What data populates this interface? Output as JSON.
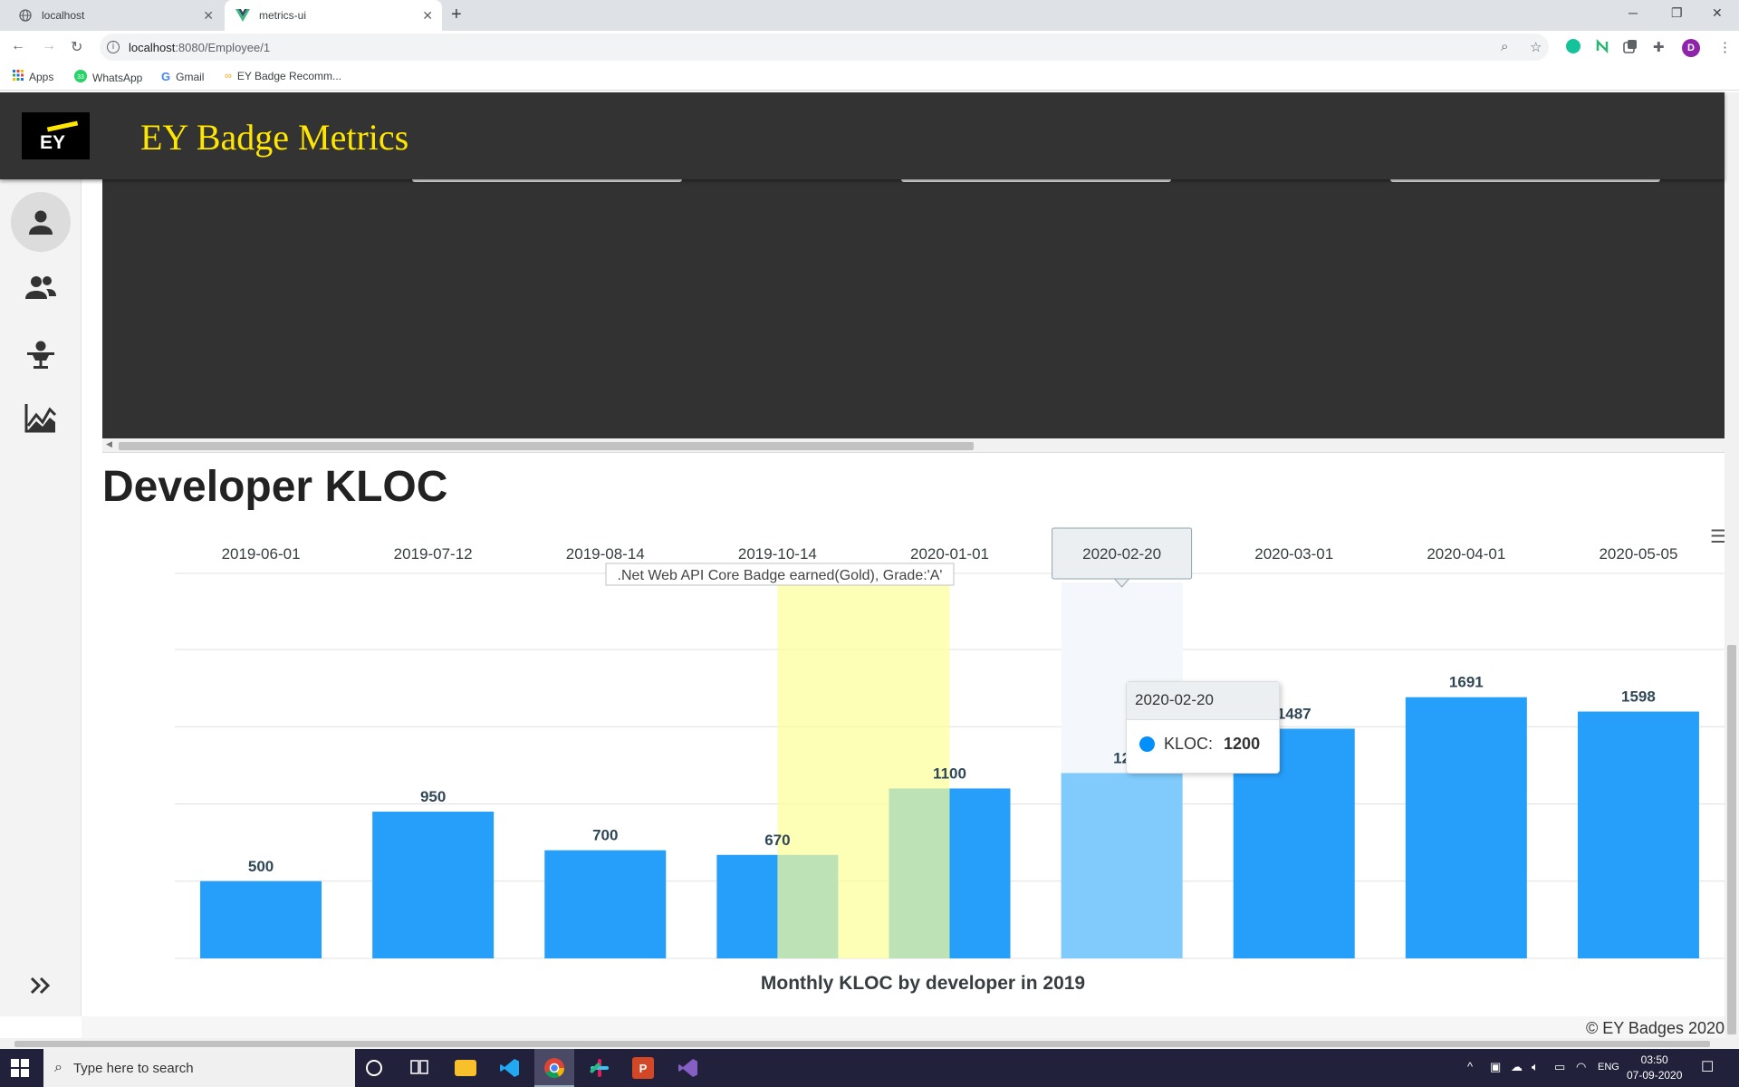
{
  "browser": {
    "tabs": [
      {
        "title": "localhost",
        "icon": "globe-icon"
      },
      {
        "title": "metrics-ui",
        "icon": "vue-icon"
      }
    ],
    "url_host": "localhost",
    "url_path": ":8080/Employee/1",
    "profile_initial": "D",
    "bookmarks": [
      {
        "label": "Apps",
        "icon": "apps-grid-icon"
      },
      {
        "label": "WhatsApp",
        "icon": "whatsapp-icon",
        "badge": "33"
      },
      {
        "label": "Gmail",
        "icon": "google-icon"
      },
      {
        "label": "EY Badge Recomm...",
        "icon": "link-icon"
      }
    ]
  },
  "app": {
    "logo_text": "EY",
    "title": "EY Badge Metrics",
    "nav_icons": [
      "person-icon",
      "people-icon",
      "presenter-icon",
      "chart-line-icon",
      "expand-icon"
    ],
    "heading": "Developer KLOC",
    "footer": "© EY Badges 2020"
  },
  "chart_data": {
    "type": "bar",
    "title": "Monthly KLOC by developer in 2019",
    "categories": [
      "2019-06-01",
      "2019-07-12",
      "2019-08-14",
      "2019-10-14",
      "2020-01-01",
      "2020-02-20",
      "2020-03-01",
      "2020-04-01",
      "2020-05-05"
    ],
    "series": [
      {
        "name": "KLOC",
        "values": [
          500,
          950,
          700,
          670,
          1100,
          1200,
          1487,
          1691,
          1598
        ],
        "color": "#269ffb"
      }
    ],
    "value_labels": [
      "500",
      "950",
      "700",
      "670",
      "1100",
      "12",
      "1487",
      "1691",
      "1598"
    ],
    "ylim": [
      0,
      2000
    ],
    "x_axis_position": "top",
    "grid": true,
    "highlighted_category": "2020-02-20",
    "annotation": {
      "label": ".Net Web API Core Badge earned(Gold), Grade:'A'",
      "from": "2019-10-14",
      "to": "2020-01-01",
      "color": "#feff99"
    },
    "tooltip": {
      "date": "2020-02-20",
      "series_label": "KLOC:",
      "value": "1200"
    }
  },
  "taskbar": {
    "search_placeholder": "Type here to search",
    "apps": [
      "cortana-icon",
      "task-view-icon",
      "file-explorer-icon",
      "vscode-icon",
      "chrome-icon",
      "slack-icon",
      "powerpoint-icon",
      "visual-studio-icon"
    ],
    "language": "ENG",
    "time": "03:50",
    "date": "07-09-2020"
  }
}
